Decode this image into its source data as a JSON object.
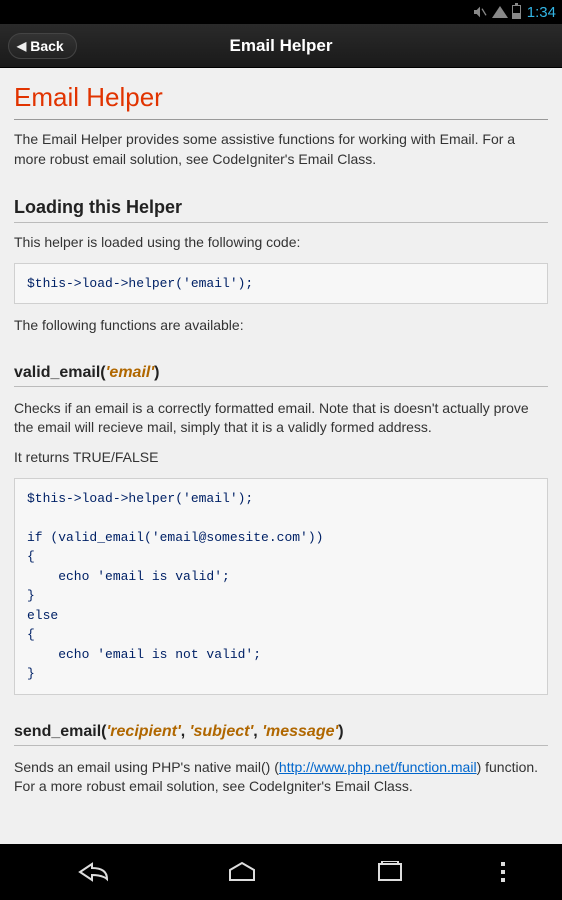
{
  "statusBar": {
    "time": "1:34"
  },
  "appBar": {
    "back": "Back",
    "title": "Email Helper"
  },
  "doc": {
    "title": "Email Helper",
    "intro": "The Email Helper provides some assistive functions for working with Email. For a more robust email solution, see CodeIgniter's Email Class.",
    "loading": {
      "title": "Loading this Helper",
      "text": "This helper is loaded using the following code:",
      "code": "$this->load->helper('email');",
      "after": "The following functions are available:"
    },
    "func1": {
      "name": "valid_email(",
      "param": "'email'",
      "close": ")",
      "desc": "Checks if an email is a correctly formatted email. Note that is doesn't actually prove the email will recieve mail, simply that it is a validly formed address.",
      "returns": "It returns TRUE/FALSE",
      "code": "$this->load->helper('email');\n\nif (valid_email('email@somesite.com'))\n{\n    echo 'email is valid';\n}\nelse\n{\n    echo 'email is not valid';\n}"
    },
    "func2": {
      "name": "send_email(",
      "p1": "'recipient'",
      "c1": ", ",
      "p2": "'subject'",
      "c2": ", ",
      "p3": "'message'",
      "close": ")",
      "desc1": "Sends an email using PHP's native mail() (",
      "link": "http://www.php.net/function.mail",
      "desc2": ") function. For a more robust email solution, see CodeIgniter's Email Class."
    }
  }
}
